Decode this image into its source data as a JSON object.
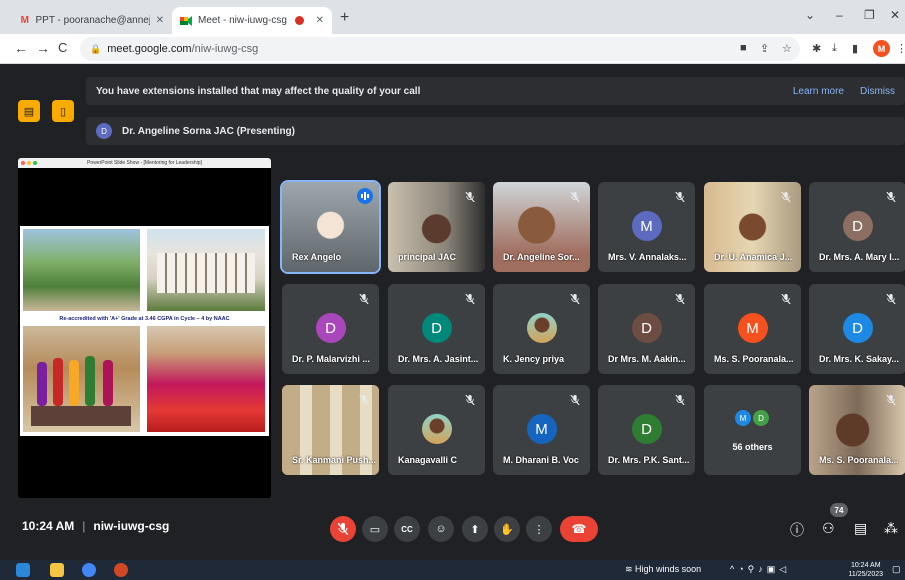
{
  "browser": {
    "tabs": [
      {
        "title": "PPT - pooranache@annejac.ac.i",
        "favicon": "gmail-icon"
      },
      {
        "title": "Meet - niw-iuwg-csg",
        "favicon": "meet-icon",
        "active": true
      }
    ],
    "url_host": "meet.google.com",
    "url_path": "/niw-iuwg-csg",
    "profile_initial": "M"
  },
  "meet": {
    "banner_text": "You have extensions installed that may affect the quality of your call",
    "learn_more": "Learn more",
    "dismiss": "Dismiss",
    "presenter_initial": "D",
    "presenting_label": "Dr. Angeline Sorna JAC (Presenting)",
    "slide_window_title": "PowerPoint Slide Show - [Mentoring for Leadership]",
    "slide_caption": "Re-accredited with 'A+' Grade at 3.46 CGPA in Cycle – 4 by NAAC",
    "participants": [
      {
        "name": "Rex Angelo",
        "type": "photo",
        "speaking": true
      },
      {
        "name": "principal JAC",
        "type": "photo"
      },
      {
        "name": "Dr. Angeline Sor...",
        "type": "photo"
      },
      {
        "name": "Mrs. V. Annalaks...",
        "type": "avatar",
        "initial": "M",
        "color": "#5c6bc0"
      },
      {
        "name": "Dr. U. Anamica J...",
        "type": "photo"
      },
      {
        "name": "Dr. Mrs. A. Mary I...",
        "type": "avatar",
        "initial": "D",
        "color": "#8d6e63"
      },
      {
        "name": "Dr. P. Malarvizhi ...",
        "type": "avatar",
        "initial": "D",
        "color": "#ab47bc"
      },
      {
        "name": "Dr. Mrs. A. Jasint...",
        "type": "avatar",
        "initial": "D",
        "color": "#00897b"
      },
      {
        "name": "K. Jency priya",
        "type": "photo-avatar"
      },
      {
        "name": "Dr Mrs. M. Aakin...",
        "type": "avatar",
        "initial": "D",
        "color": "#6d4c41"
      },
      {
        "name": "Ms. S. Pooranala...",
        "type": "avatar",
        "initial": "M",
        "color": "#f4511e"
      },
      {
        "name": "Dr. Mrs. K. Sakay...",
        "type": "avatar",
        "initial": "D",
        "color": "#1e88e5"
      },
      {
        "name": "Sr. Kanmani Push...",
        "type": "photo"
      },
      {
        "name": "Kanagavalli C",
        "type": "photo-avatar"
      },
      {
        "name": "M. Dharani B. Voc",
        "type": "avatar",
        "initial": "M",
        "color": "#1565c0"
      },
      {
        "name": "Dr. Mrs. P.K. Sant...",
        "type": "avatar",
        "initial": "D",
        "color": "#2e7d32"
      },
      {
        "name": "56 others",
        "type": "others",
        "initials": [
          "M",
          "D"
        ]
      },
      {
        "name": "Ms. S. Pooranala...",
        "type": "photo"
      }
    ],
    "time": "10:24 AM",
    "meeting_code": "niw-iuwg-csg",
    "people_count": "74"
  },
  "taskbar": {
    "weather": "High winds soon",
    "time": "10:24 AM",
    "date": "11/25/2023"
  }
}
